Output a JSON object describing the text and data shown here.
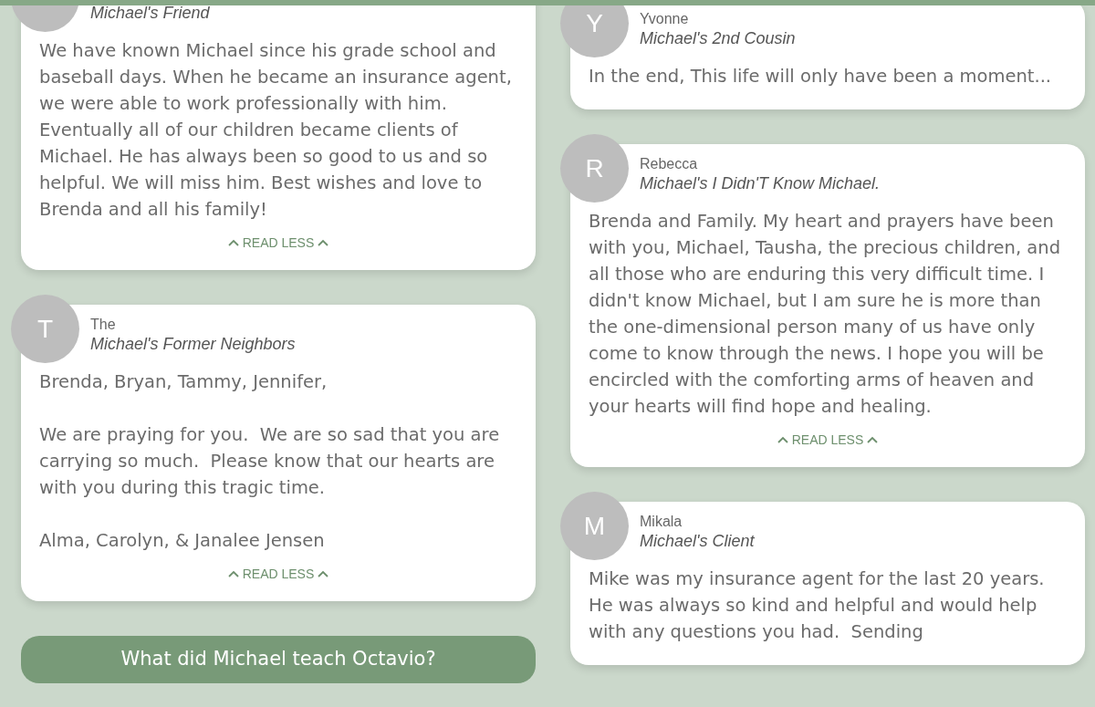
{
  "columns": [
    {
      "cards": [
        {
          "relation": "Michael's Friend",
          "message": "We have known Michael since his grade school and baseball days. When he became an insurance agent, we were able to work professionally with him. Eventually all of our children became clients of Michael. He has always been so good to us and so helpful. We will miss him. Best wishes and love to Brenda and all his family!",
          "toggle": "READ LESS",
          "expanded": true
        },
        {
          "initial": "T",
          "name": "The",
          "relation": "Michael's Former Neighbors",
          "message": "Brenda, Bryan, Tammy, Jennifer,\n\nWe are praying for you.  We are so sad that you are carrying so much.  Please know that our hearts are with you during this tragic time.\n\nAlma, Carolyn, & Janalee Jensen",
          "toggle": "READ LESS",
          "expanded": true
        }
      ],
      "button": "What did Michael teach Octavio?"
    },
    {
      "cards": [
        {
          "initial": "Y",
          "name": "Yvonne",
          "relation": "Michael's 2nd Cousin",
          "message": "In the end, This life will only have been a moment..."
        },
        {
          "initial": "R",
          "name": "Rebecca",
          "relation": "Michael's I Didn'T Know Michael.",
          "message": "Brenda and Family. My heart and prayers have been with you, Michael, Tausha, the precious children, and all those who are enduring this very difficult time. I didn't know Michael, but I am sure he is more than the one-dimensional person many of us have only come to know through the news. I hope you will be encircled with the comforting arms of heaven and your hearts will find hope and healing.",
          "toggle": "READ LESS",
          "expanded": true
        },
        {
          "initial": "M",
          "name": "Mikala",
          "relation": "Michael's Client",
          "message": "Mike was my insurance agent for the last 20 years.  He was always so kind and helpful and would help with any questions you had.  Sending"
        }
      ]
    }
  ]
}
